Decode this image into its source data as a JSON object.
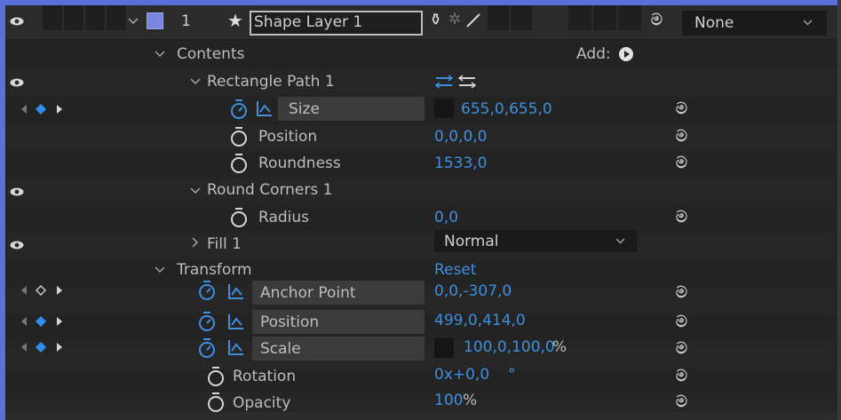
{
  "layer": {
    "index": "1",
    "name": "Shape Layer 1",
    "color": "#7a84e3",
    "parent_value": "None"
  },
  "contents": {
    "label": "Contents",
    "add_label": "Add:"
  },
  "rect_path": {
    "label": "Rectangle Path 1",
    "size": {
      "label": "Size",
      "value": "655,0,655,0"
    },
    "position": {
      "label": "Position",
      "value": "0,0,0,0"
    },
    "roundness": {
      "label": "Roundness",
      "value": "1533,0"
    }
  },
  "round_corners": {
    "label": "Round Corners 1",
    "radius": {
      "label": "Radius",
      "value": "0,0"
    }
  },
  "fill": {
    "label": "Fill 1",
    "blend_mode": "Normal"
  },
  "transform": {
    "label": "Transform",
    "reset_label": "Reset",
    "anchor_point": {
      "label": "Anchor Point",
      "value": "0,0,-307,0"
    },
    "position": {
      "label": "Position",
      "value": "499,0,414,0"
    },
    "scale": {
      "label": "Scale",
      "value": "100,0,100,0",
      "unit": "%"
    },
    "rotation": {
      "label": "Rotation",
      "value": "0x+0,0",
      "unit": "°"
    },
    "opacity": {
      "label": "Opacity",
      "value": "100",
      "unit": "%"
    }
  },
  "colors": {
    "accent": "#3f8fe0",
    "keyframe": "#2f8ef0",
    "frame": "#5b6fd8"
  },
  "icons": [
    "eye-icon",
    "chevron-down-icon",
    "chevron-right-icon",
    "star-icon",
    "stopwatch-icon",
    "graph-icon",
    "spiral-icon",
    "keyframe-nav-icon",
    "play-icon",
    "path-direction-icon"
  ]
}
